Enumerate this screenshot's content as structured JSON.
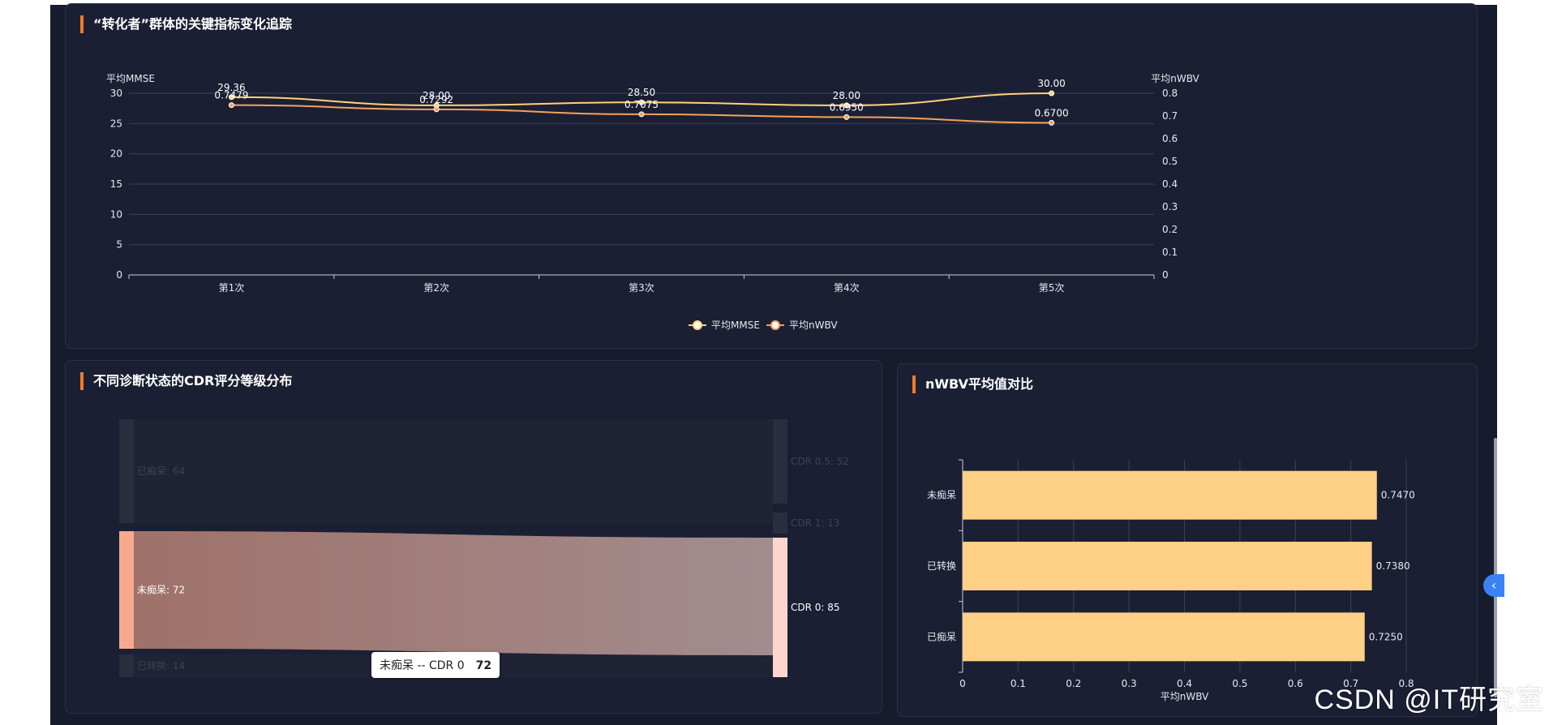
{
  "panels": {
    "trend_title": "“转化者”群体的关键指标变化追踪",
    "sankey_title": "不同诊断状态的CDR评分等级分布",
    "bar_title": "nWBV平均值对比"
  },
  "colors": {
    "accent": "#f07b2b",
    "mmse_line": "#ffd27a",
    "nwbv_line": "#f5a25c",
    "bar_fill": "#fdd085",
    "sankey_source_active": "#f7a98e",
    "sankey_target_active": "#fdd5cc"
  },
  "chart_data": [
    {
      "type": "line",
      "categories": [
        "第1次",
        "第2次",
        "第3次",
        "第4次",
        "第5次"
      ],
      "y_left": {
        "label": "平均MMSE",
        "ticks": [
          0,
          5,
          10,
          15,
          20,
          25,
          30
        ],
        "range": [
          0,
          30
        ]
      },
      "y_right": {
        "label": "平均nWBV",
        "ticks": [
          0,
          0.1,
          0.2,
          0.3,
          0.4,
          0.5,
          0.6,
          0.7,
          0.8
        ],
        "range": [
          0,
          0.8
        ]
      },
      "series": [
        {
          "name": "平均MMSE",
          "axis": "left",
          "values": [
            29.36,
            28.0,
            28.5,
            28.0,
            30.0
          ],
          "labels": [
            "29.36",
            "28.00",
            "28.50",
            "28.00",
            "30.00"
          ]
        },
        {
          "name": "平均nWBV",
          "axis": "right",
          "values": [
            0.7479,
            0.7292,
            0.7075,
            0.695,
            0.67
          ],
          "labels": [
            "0.7479",
            "0.7292",
            "0.7075",
            "0.6950",
            "0.6700"
          ]
        }
      ],
      "legend": "bottom-center",
      "grid": true
    },
    {
      "type": "sankey",
      "sources": [
        {
          "name": "已痴呆",
          "value": 64,
          "label": "已痴呆: 64"
        },
        {
          "name": "未痴呆",
          "value": 72,
          "label": "未痴呆: 72"
        },
        {
          "name": "已转换",
          "value": 14,
          "label": "已转换: 14"
        }
      ],
      "targets": [
        {
          "name": "CDR 0.5",
          "value": 52,
          "label": "CDR 0.5: 52"
        },
        {
          "name": "CDR 1",
          "value": 13,
          "label": "CDR 1: 13"
        },
        {
          "name": "CDR 0",
          "value": 85,
          "label": "CDR 0: 85"
        }
      ],
      "highlighted_link": {
        "source": "未痴呆",
        "target": "CDR 0",
        "value": 72
      },
      "tooltip": {
        "text": "未痴呆 -- CDR 0",
        "value": "72"
      }
    },
    {
      "type": "bar",
      "orientation": "horizontal",
      "categories": [
        "未痴呆",
        "已转换",
        "已痴呆"
      ],
      "values": [
        0.747,
        0.738,
        0.725
      ],
      "labels": [
        "0.7470",
        "0.7380",
        "0.7250"
      ],
      "xlabel": "平均nWBV",
      "xlim": [
        0,
        0.8
      ],
      "ticks": [
        "0",
        "0.1",
        "0.2",
        "0.3",
        "0.4",
        "0.5",
        "0.6",
        "0.7",
        "0.8"
      ]
    }
  ],
  "watermark": "CSDN @IT研究室"
}
